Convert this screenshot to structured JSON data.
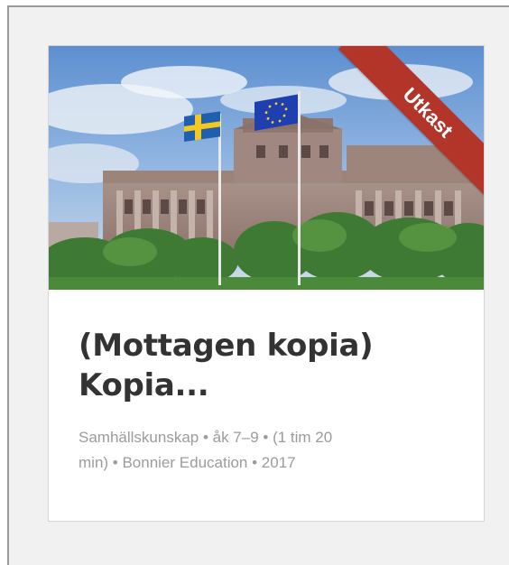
{
  "card": {
    "badge": "Utkast",
    "title_line1": "(Mottagen kopia)",
    "title_line2": "Kopia...",
    "meta_line1": "Samhällskunskap • åk 7–9 • (1 tim 20",
    "meta_line2": "min) • Bonnier Education • 2017",
    "image_subject": "riksdag-building-photo",
    "badge_color": "#b3352a"
  }
}
